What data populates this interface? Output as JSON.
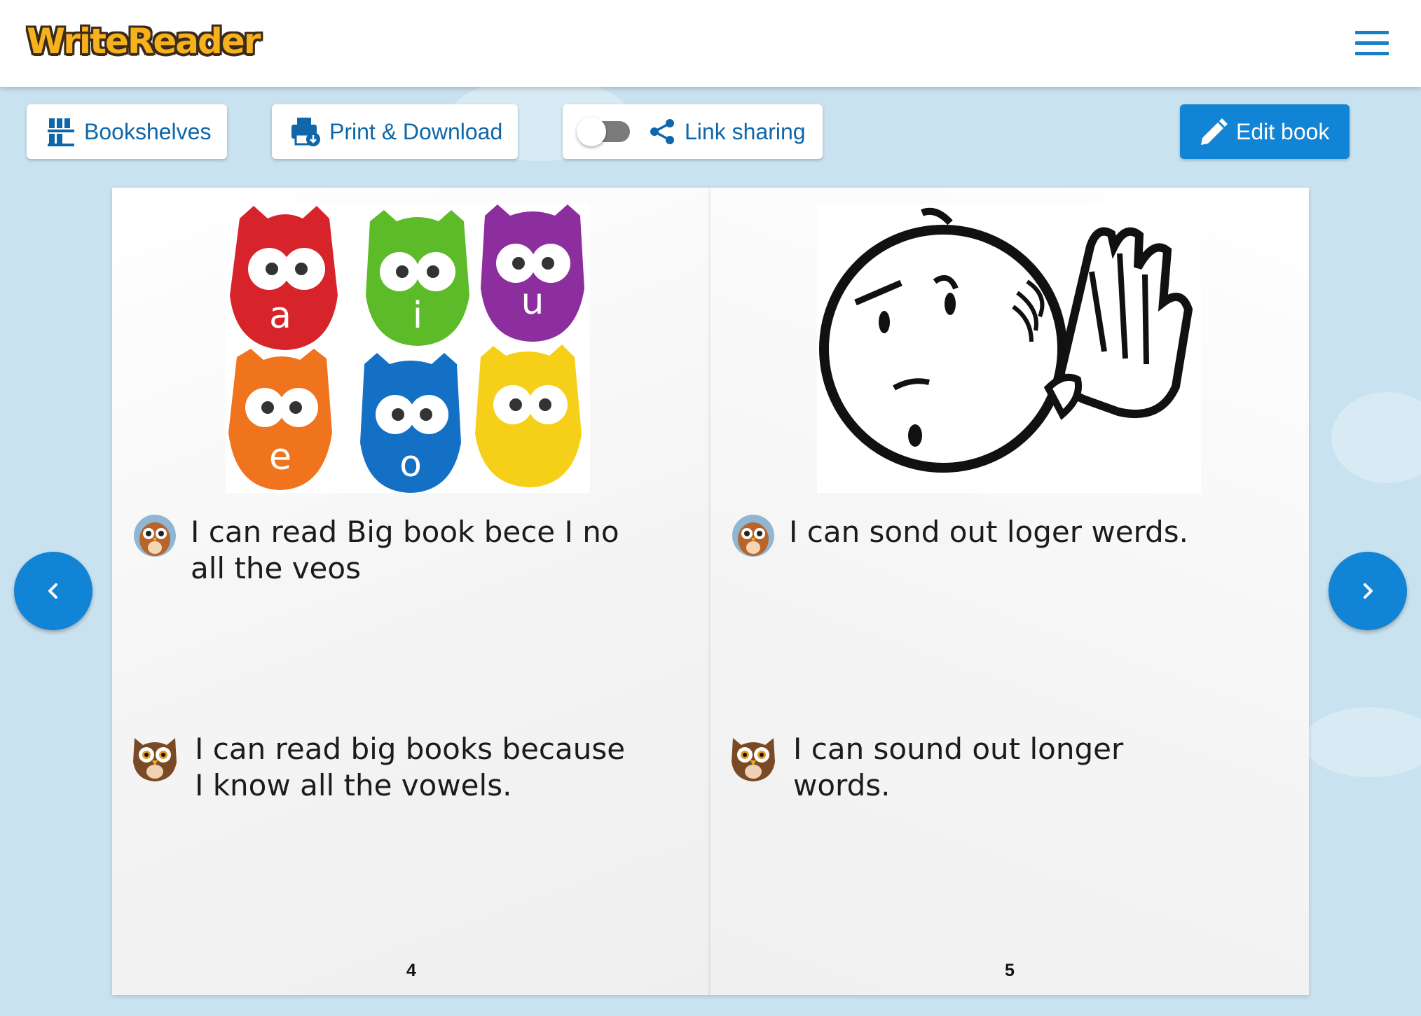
{
  "header": {
    "logo_text": "WriteReader",
    "menu_icon": "hamburger-menu-icon"
  },
  "toolbar": {
    "bookshelves_label": "Bookshelves",
    "print_label": "Print & Download",
    "link_sharing_label": "Link sharing",
    "link_sharing_enabled": false,
    "edit_label": "Edit book"
  },
  "book": {
    "pages": [
      {
        "illustration": "six-owl-vowel-cups",
        "illustration_letters": [
          "a",
          "i",
          "u",
          "e",
          "o"
        ],
        "child_text": "I can read Big book bece I no all the veos",
        "adult_text": "I can read big books because I know all the vowels.",
        "page_number": "4"
      },
      {
        "illustration": "listening-face-drawing",
        "child_text": "I can sond out loger werds.",
        "adult_text": "I can sound out longer words.",
        "page_number": "5"
      }
    ]
  },
  "colors": {
    "brand_blue": "#1284d6",
    "link_blue": "#0f66a8",
    "background": "#c9e2ef",
    "logo_orange": "#f6b21c"
  }
}
